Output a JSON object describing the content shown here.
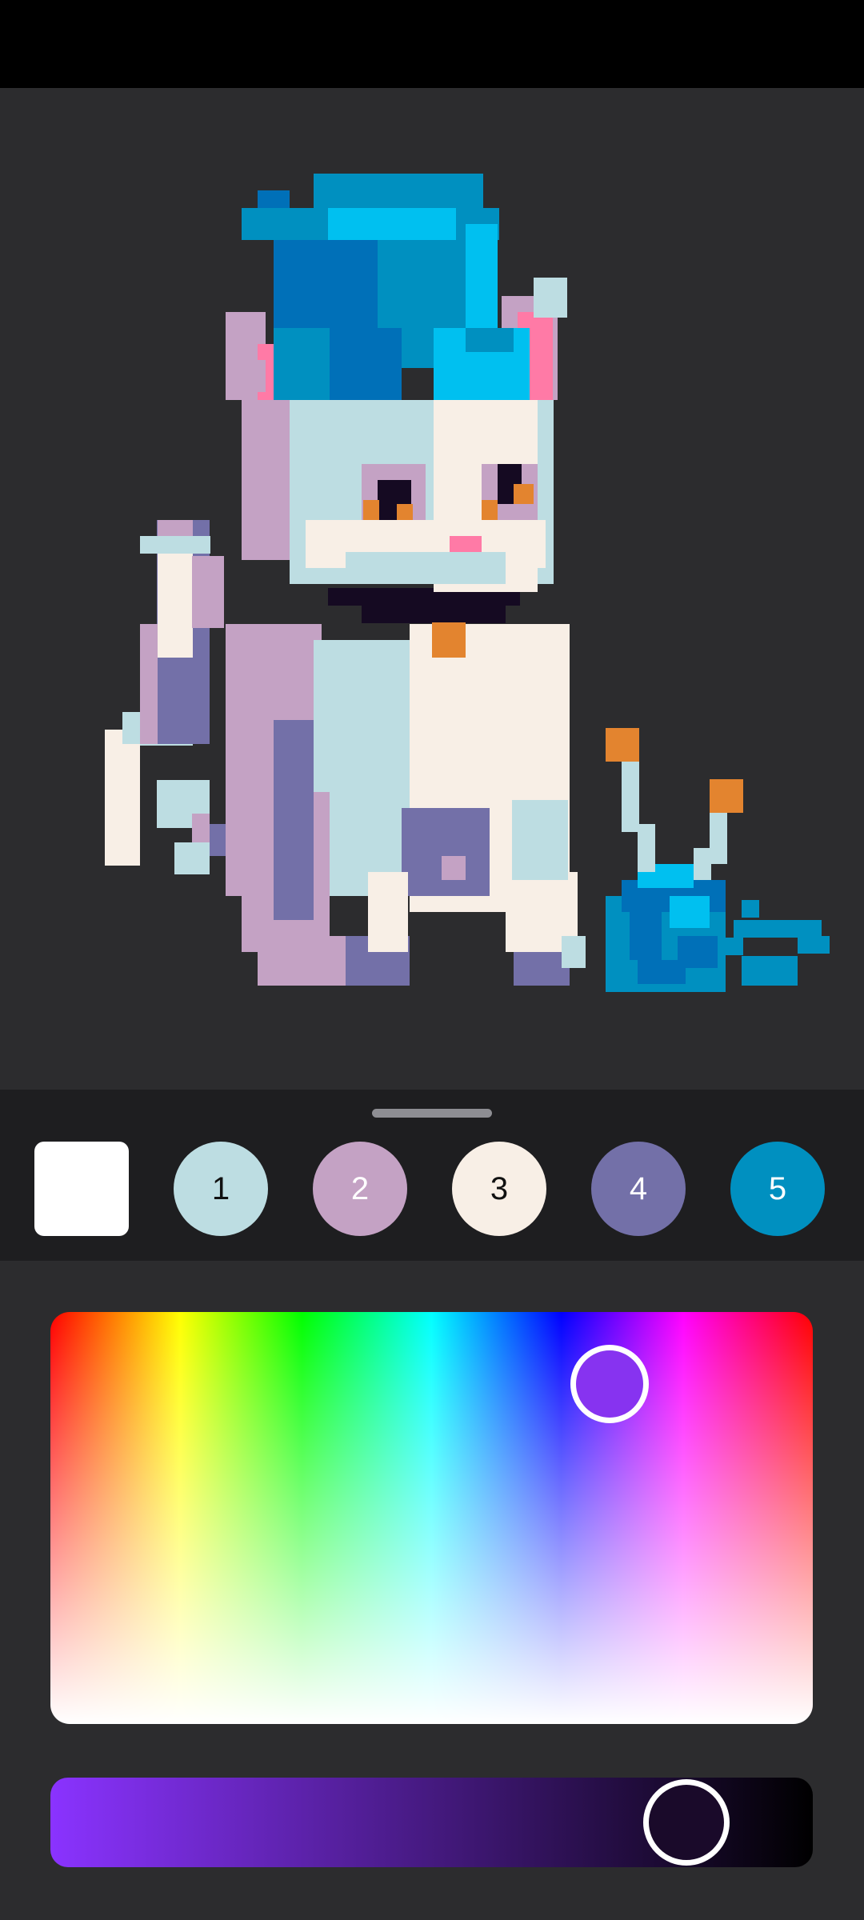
{
  "canvas": {
    "background": "#2c2c2e",
    "pixel_colors": {
      "teal_light": "#bddde2",
      "lilac": "#c4a2c4",
      "cream": "#f8efe6",
      "purple": "#7370a8",
      "blue": "#0090c0",
      "sky": "#00c0f0",
      "navy": "#0070b8",
      "pink": "#ff7aa6",
      "orange": "#e3842f",
      "dark": "#150a22"
    }
  },
  "palette": {
    "swatches": [
      {
        "label": "",
        "color": "#ffffff",
        "shape": "square"
      },
      {
        "label": "1",
        "color": "#bddde2",
        "shape": "circle",
        "text_color": "#111111"
      },
      {
        "label": "2",
        "color": "#c4a2c4",
        "shape": "circle",
        "text_color": "#ffffff"
      },
      {
        "label": "3",
        "color": "#f8efe6",
        "shape": "circle",
        "text_color": "#111111"
      },
      {
        "label": "4",
        "color": "#7370a8",
        "shape": "circle",
        "text_color": "#ffffff"
      },
      {
        "label": "5",
        "color": "#0090c0",
        "shape": "circle",
        "text_color": "#ffffff"
      }
    ]
  },
  "color_picker": {
    "selected_hue_color": "#8733f0",
    "brightness_start": "#8a33ff",
    "brightness_end": "#000000",
    "brightness_selected": "#1a0a2a"
  }
}
